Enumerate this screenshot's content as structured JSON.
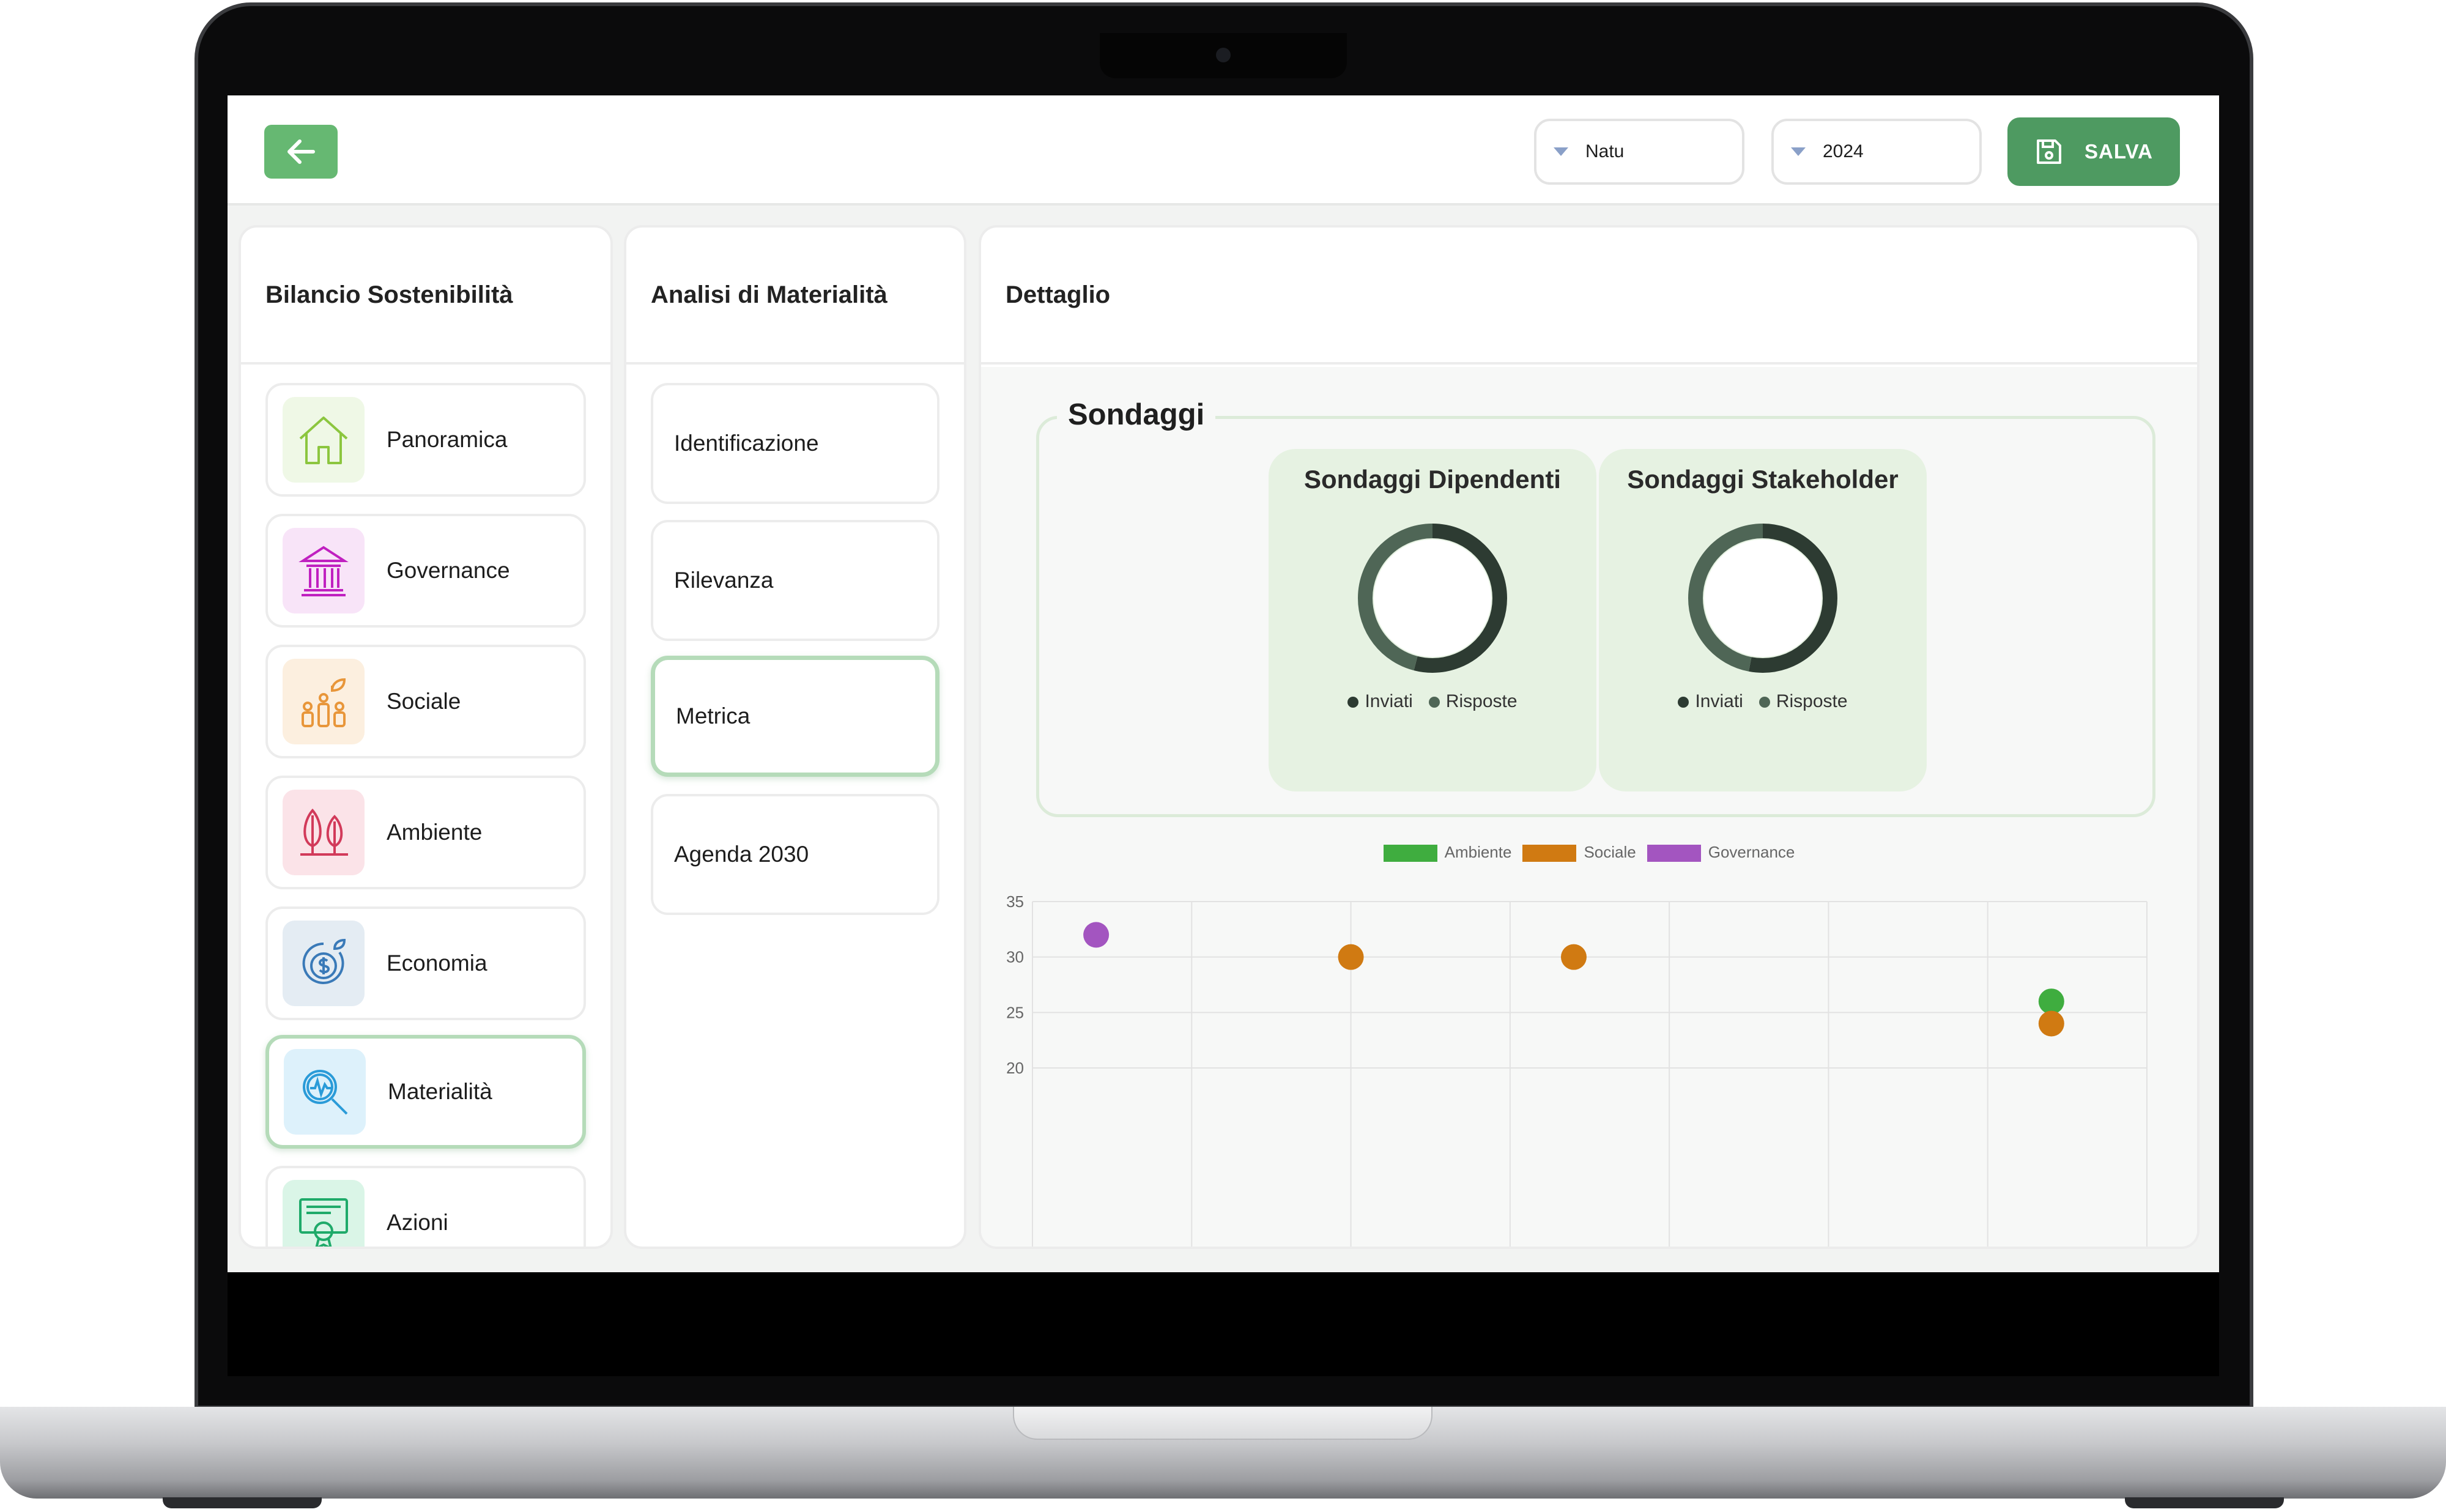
{
  "topbar": {
    "company_select": "Natu",
    "year_select": "2024",
    "save_label": "SALVA",
    "colors": {
      "accent": "#4e9a61",
      "back": "#66b872"
    }
  },
  "sidebar": {
    "title": "Bilancio Sostenibilità",
    "items": [
      {
        "label": "Panoramica",
        "icon": "home-icon",
        "color": "#8cc63f",
        "bg": "#eff8e6"
      },
      {
        "label": "Governance",
        "icon": "bank-icon",
        "color": "#c020c0",
        "bg": "#f8e4f8"
      },
      {
        "label": "Sociale",
        "icon": "people-growth-icon",
        "color": "#e8963a",
        "bg": "#fcefdf"
      },
      {
        "label": "Ambiente",
        "icon": "trees-icon",
        "color": "#d23a5a",
        "bg": "#fbe3e8"
      },
      {
        "label": "Economia",
        "icon": "dollar-cycle-icon",
        "color": "#3a7ab8",
        "bg": "#e4ecf3"
      },
      {
        "label": "Materialità",
        "icon": "magnifier-icon",
        "color": "#2a9bd8",
        "bg": "#ddf1fb"
      },
      {
        "label": "Azioni",
        "icon": "certificate-icon",
        "color": "#1faa6a",
        "bg": "#daf5e7"
      }
    ]
  },
  "middle": {
    "title": "Analisi di Materialità",
    "items": [
      "Identificazione",
      "Rilevanza",
      "Metrica",
      "Agenda 2030"
    ]
  },
  "detail": {
    "title": "Dettaglio",
    "section_title": "Sondaggi",
    "donuts": [
      {
        "title": "Sondaggi Dipendenti",
        "legend": [
          "Inviati",
          "Risposte"
        ],
        "values": [
          0.54,
          0.46
        ]
      },
      {
        "title": "Sondaggi Stakeholder",
        "legend": [
          "Inviati",
          "Risposte"
        ],
        "values": [
          0.53,
          0.47
        ]
      }
    ],
    "donut_colors": [
      "#2d3b32",
      "#4f6656"
    ]
  },
  "chart_data": {
    "type": "scatter",
    "series": [
      {
        "name": "Ambiente",
        "color": "#3fad3f",
        "points": [
          [
            7,
            26
          ]
        ]
      },
      {
        "name": "Sociale",
        "color": "#d07a12",
        "points": [
          [
            2.6,
            30
          ],
          [
            4,
            30
          ],
          [
            7,
            24
          ]
        ]
      },
      {
        "name": "Governance",
        "color": "#a355c0",
        "points": [
          [
            1,
            32
          ]
        ]
      }
    ],
    "y_ticks": [
      "35",
      "30",
      "25",
      "20"
    ],
    "ylim": [
      20,
      35
    ],
    "xlim": [
      0.6,
      7.6
    ],
    "legend_position": "top",
    "grid": true
  }
}
